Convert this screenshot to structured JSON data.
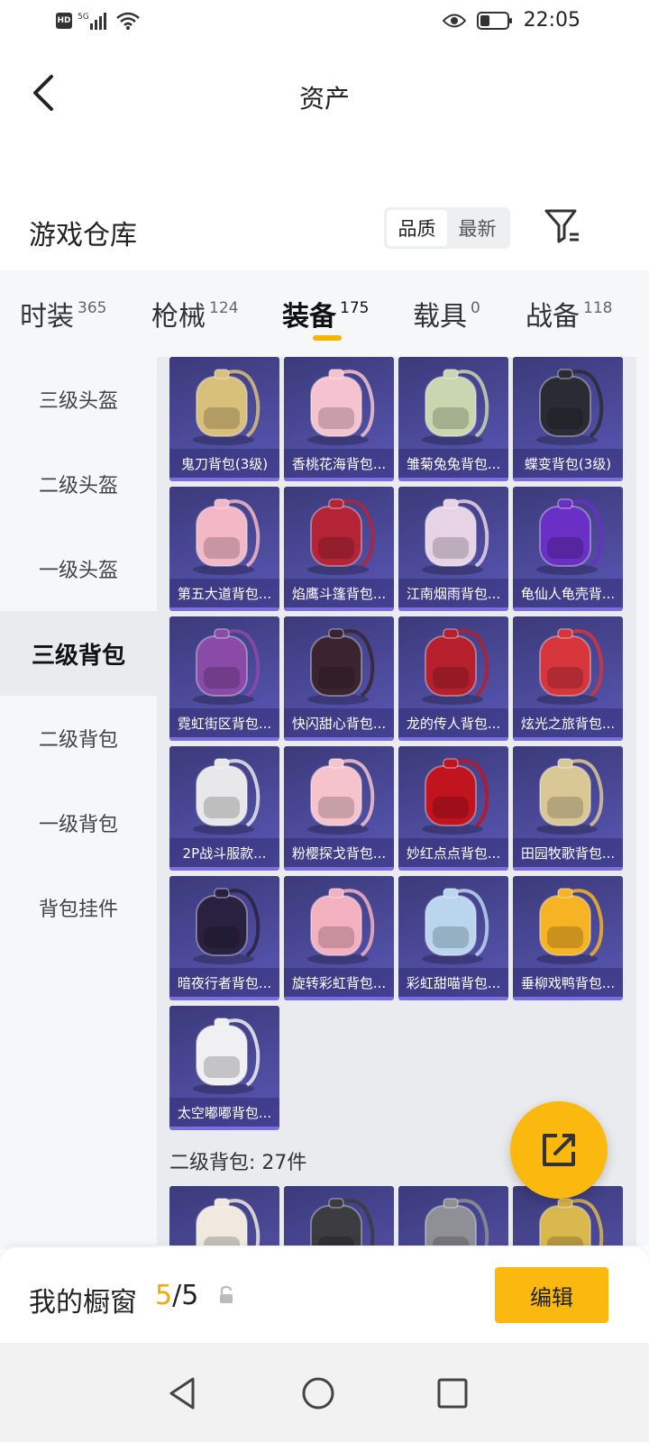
{
  "status": {
    "time": "22:05",
    "signal_label": "5G"
  },
  "header": {
    "title": "资产"
  },
  "section": {
    "title": "游戏仓库",
    "sort_quality": "品质",
    "sort_newest": "最新"
  },
  "tabs": [
    {
      "label": "时装",
      "count": "365"
    },
    {
      "label": "枪械",
      "count": "124"
    },
    {
      "label": "装备",
      "count": "175"
    },
    {
      "label": "载具",
      "count": "0"
    },
    {
      "label": "战备",
      "count": "118"
    }
  ],
  "sidebar": {
    "items": [
      {
        "label": "三级头盔"
      },
      {
        "label": "二级头盔"
      },
      {
        "label": "一级头盔"
      },
      {
        "label": "三级背包"
      },
      {
        "label": "二级背包"
      },
      {
        "label": "一级背包"
      },
      {
        "label": "背包挂件"
      }
    ],
    "active_index": 3
  },
  "items": [
    {
      "name": "鬼刀背包(3级)",
      "color": "#d8c07a"
    },
    {
      "name": "香桃花海背包...",
      "color": "#f4c3cf"
    },
    {
      "name": "雏菊兔兔背包...",
      "color": "#c9d6b0"
    },
    {
      "name": "蝶变背包(3级)",
      "color": "#2b2b35"
    },
    {
      "name": "第五大道背包...",
      "color": "#f2b8c6"
    },
    {
      "name": "焰鹰斗篷背包...",
      "color": "#b32436"
    },
    {
      "name": "江南烟雨背包...",
      "color": "#e7d3e6"
    },
    {
      "name": "龟仙人龟壳背...",
      "color": "#6a2fc4"
    },
    {
      "name": "霓虹街区背包...",
      "color": "#8a4aa8"
    },
    {
      "name": "快闪甜心背包...",
      "color": "#3a2430"
    },
    {
      "name": "龙的传人背包...",
      "color": "#b5202c"
    },
    {
      "name": "炫光之旅背包...",
      "color": "#d6353c"
    },
    {
      "name": "2P战斗服款...",
      "color": "#e8e8ea"
    },
    {
      "name": "粉樱探戈背包...",
      "color": "#f6c2cc"
    },
    {
      "name": "妙红点点背包...",
      "color": "#c1141f"
    },
    {
      "name": "田园牧歌背包...",
      "color": "#d9c896"
    },
    {
      "name": "暗夜行者背包...",
      "color": "#2a2140"
    },
    {
      "name": "旋转彩虹背包...",
      "color": "#f3b0bf"
    },
    {
      "name": "彩虹甜喵背包...",
      "color": "#b9d6ee"
    },
    {
      "name": "垂柳戏鸭背包...",
      "color": "#f6b324"
    },
    {
      "name": "太空嘟嘟背包...",
      "color": "#f0f0f2"
    }
  ],
  "subsection": {
    "label": "二级背包: 27件"
  },
  "peek_items": [
    {
      "color": "#efe9df"
    },
    {
      "color": "#3b3b40"
    },
    {
      "color": "#8f8f96"
    },
    {
      "color": "#d9b84e"
    }
  ],
  "showcase": {
    "label": "我的橱窗",
    "current": "5",
    "sep_total": "/5",
    "edit_label": "编辑"
  },
  "colors": {
    "accent": "#fbb80f",
    "card_bg": "#4a4896",
    "card_border": "#7b6fe0"
  }
}
